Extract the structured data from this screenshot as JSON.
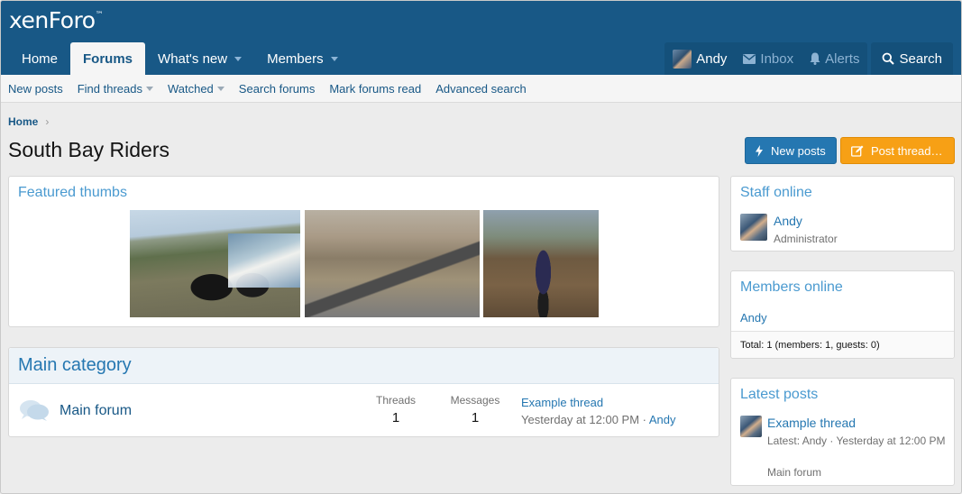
{
  "logo": {
    "text": "xenForo",
    "mark": "™"
  },
  "nav": {
    "tabs": [
      {
        "label": "Home"
      },
      {
        "label": "Forums"
      },
      {
        "label": "What's new"
      },
      {
        "label": "Members"
      }
    ],
    "user": "Andy",
    "inbox": "Inbox",
    "alerts": "Alerts",
    "search": "Search"
  },
  "subnav": {
    "items": [
      "New posts",
      "Find threads",
      "Watched",
      "Search forums",
      "Mark forums read",
      "Advanced search"
    ]
  },
  "breadcrumb": {
    "home": "Home",
    "sep": "›"
  },
  "page": {
    "title": "South Bay Riders"
  },
  "buttons": {
    "new_posts": "New posts",
    "post_thread": "Post thread…"
  },
  "featured": {
    "title": "Featured thumbs"
  },
  "category": {
    "title": "Main category",
    "forum": {
      "name": "Main forum",
      "threads_label": "Threads",
      "threads": "1",
      "messages_label": "Messages",
      "messages": "1",
      "last_thread": "Example thread",
      "last_time": "Yesterday at 12:00 PM · ",
      "last_user": "Andy"
    }
  },
  "sidebar": {
    "staff": {
      "title": "Staff online",
      "name": "Andy",
      "role": "Administrator"
    },
    "members": {
      "title": "Members online",
      "name": "Andy",
      "total": "Total: 1 (members: 1, guests: 0)"
    },
    "latest": {
      "title": "Latest posts",
      "thread": "Example thread",
      "meta": "Latest: Andy · Yesterday at 12:00 PM",
      "forum": "Main forum"
    }
  },
  "colors": {
    "header": "#185886",
    "accent": "#2577b1",
    "link_light": "#4a9ad0",
    "orange": "#f7a015"
  }
}
